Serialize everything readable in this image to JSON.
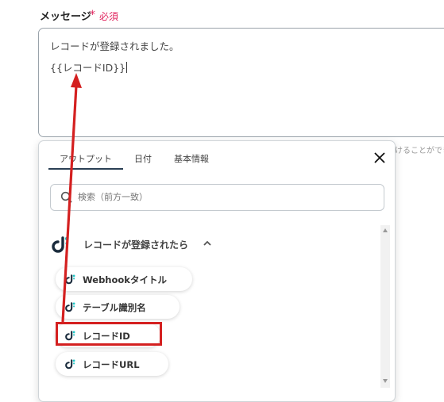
{
  "field": {
    "label": "メッセージ",
    "required_mark": "*",
    "required_text": "必須"
  },
  "textarea": {
    "line1": "レコードが登録されました。",
    "line2": "{{レコードID}}"
  },
  "side_hint": "けることができ",
  "panel": {
    "tabs": [
      {
        "label": "アウトプット",
        "active": true
      },
      {
        "label": "日付",
        "active": false
      },
      {
        "label": "基本情報",
        "active": false
      }
    ],
    "search_placeholder": "検索（前方一致）",
    "group_title": "レコードが登録されたら",
    "items": [
      {
        "label": "Webhookタイトル"
      },
      {
        "label": "テーブル識別名"
      },
      {
        "label": "レコードID",
        "highlighted": true
      },
      {
        "label": "レコードURL"
      }
    ]
  },
  "colors": {
    "accent": "#2a3f54",
    "required": "#e0245e",
    "annotation": "#d42020",
    "logo_dark": "#1a2b3c",
    "logo_teal": "#21c7c7"
  },
  "icons": [
    "search-icon",
    "close-icon",
    "yoom-logo-icon",
    "chevron-up-icon"
  ]
}
